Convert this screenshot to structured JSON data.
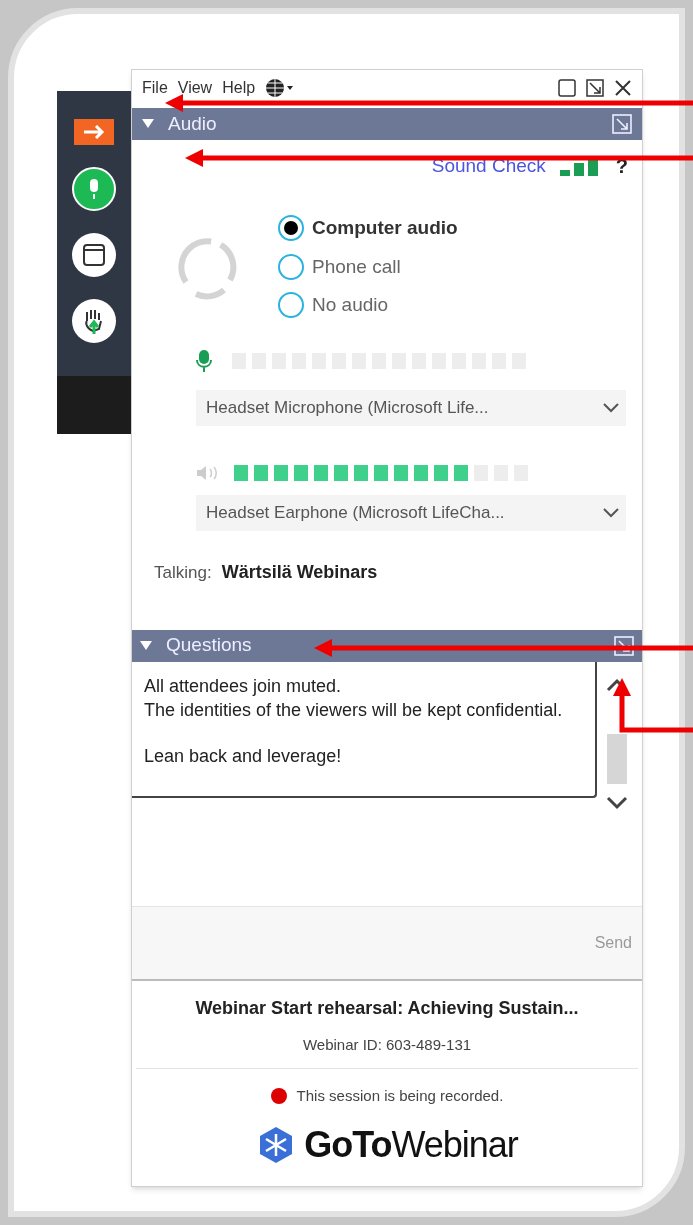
{
  "menu": [
    {
      "label": "File"
    },
    {
      "label": "View"
    },
    {
      "label": "Help"
    }
  ],
  "audio": {
    "title": "Audio",
    "expanded": true,
    "sound_check": "Sound Check",
    "help": "?",
    "options": [
      {
        "label": "Computer audio",
        "selected": true
      },
      {
        "label": "Phone call",
        "selected": false
      },
      {
        "label": "No audio",
        "selected": false
      }
    ],
    "mic": {
      "level": 0,
      "device": "Headset Microphone (Microsoft Life..."
    },
    "speaker": {
      "level": 0.8,
      "device": "Headset Earphone (Microsoft LifeCha..."
    },
    "talking_label": "Talking:",
    "talking_name": "Wärtsilä Webinars"
  },
  "questions": {
    "title": "Questions",
    "expanded": true,
    "paragraphs": [
      [
        "All attendees join muted.",
        "The identities of the viewers will be kept confidential."
      ],
      [
        "Lean back and leverage!"
      ]
    ],
    "send": "Send"
  },
  "webinar": {
    "title": "Webinar Start rehearsal: Achieving Sustain...",
    "id": "Webinar ID: 603-489-131",
    "recording": true,
    "recording_text": "This session is being recorded."
  },
  "logo": {
    "bold": "GoTo",
    "light": "Webinar"
  }
}
